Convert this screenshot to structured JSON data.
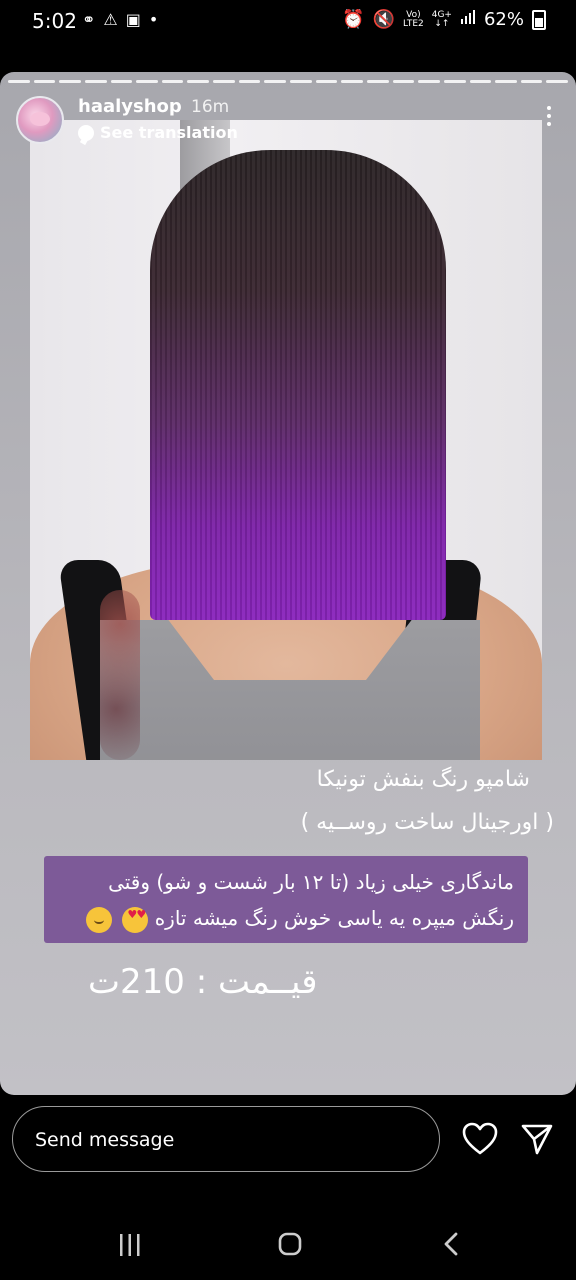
{
  "status_bar": {
    "time": "5:02",
    "network_top": "Vo)",
    "network_bottom": "LTE2",
    "signal_top": "4G+",
    "battery": "62%"
  },
  "story": {
    "username": "haalyshop",
    "time_ago": "16m",
    "translate_label": "See translation",
    "caption_line1": "شامپو رنگ بنفش تونیکا",
    "caption_line2": "( اورجینال ساخت روســیه )",
    "purple_box_line1": "ماندگاری خیلی زیاد (تا ۱۲ بار شست و شو) وقتی",
    "purple_box_line2": "رنگش میپره یه یاسی خوش رنگ میشه تازه",
    "price": "قیــمت : 210ت",
    "emojis": [
      "heart-eyes-emoji",
      "teary-smile-emoji"
    ],
    "accent_box_color": "#7d5a98"
  },
  "reply_bar": {
    "placeholder": "Send message"
  },
  "icons": [
    "alarm-icon",
    "mute-icon",
    "signal-icon",
    "battery-icon",
    "heart-icon",
    "send-icon",
    "more-icon",
    "translate-icon",
    "recent-apps-icon",
    "home-icon",
    "back-icon"
  ]
}
